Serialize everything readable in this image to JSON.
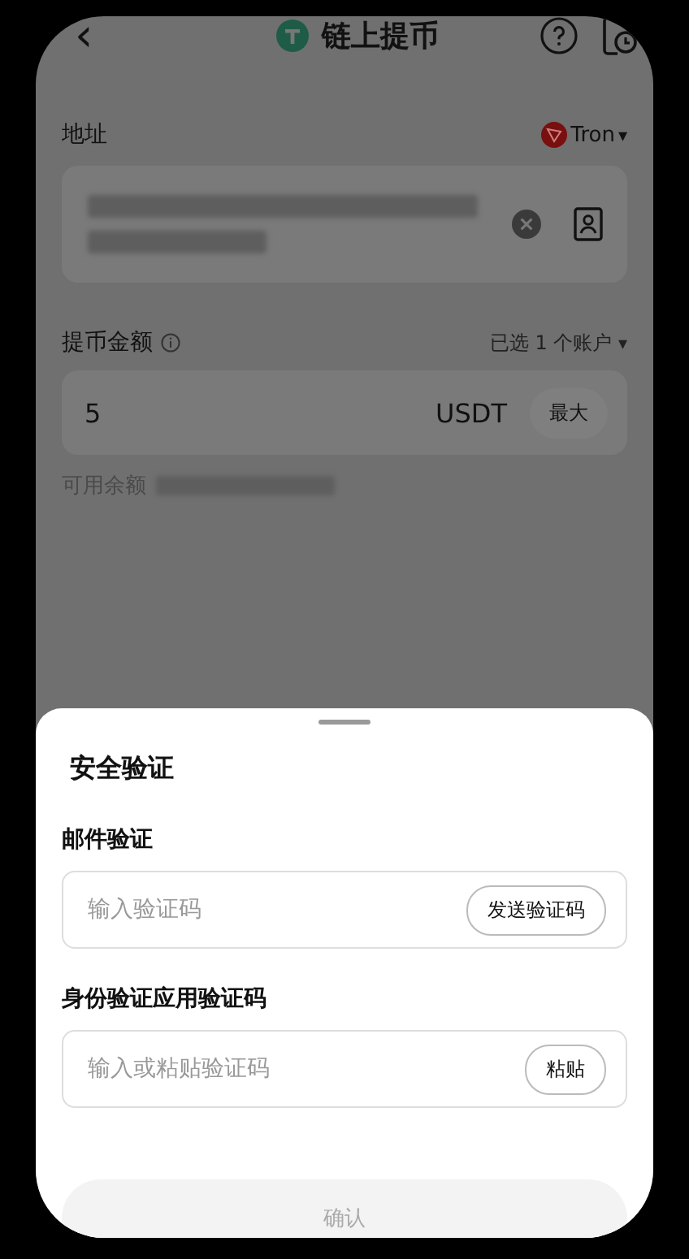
{
  "header": {
    "back": "‹",
    "title": "链上提币"
  },
  "address": {
    "label": "地址",
    "network": "Tron",
    "network_caret": "▾"
  },
  "amount": {
    "label": "提币金额",
    "accounts": "已选 1 个账户",
    "accounts_caret": "▾",
    "value": "5",
    "currency": "USDT",
    "max": "最大",
    "available_label": "可用余额"
  },
  "sheet": {
    "title": "安全验证",
    "fields": [
      {
        "label": "邮件验证",
        "placeholder": "输入验证码",
        "action": "发送验证码"
      },
      {
        "label": "身份验证应用验证码",
        "placeholder": "输入或粘贴验证码",
        "action": "粘贴"
      }
    ],
    "confirm": {
      "label": "确认",
      "disabled": true
    }
  }
}
